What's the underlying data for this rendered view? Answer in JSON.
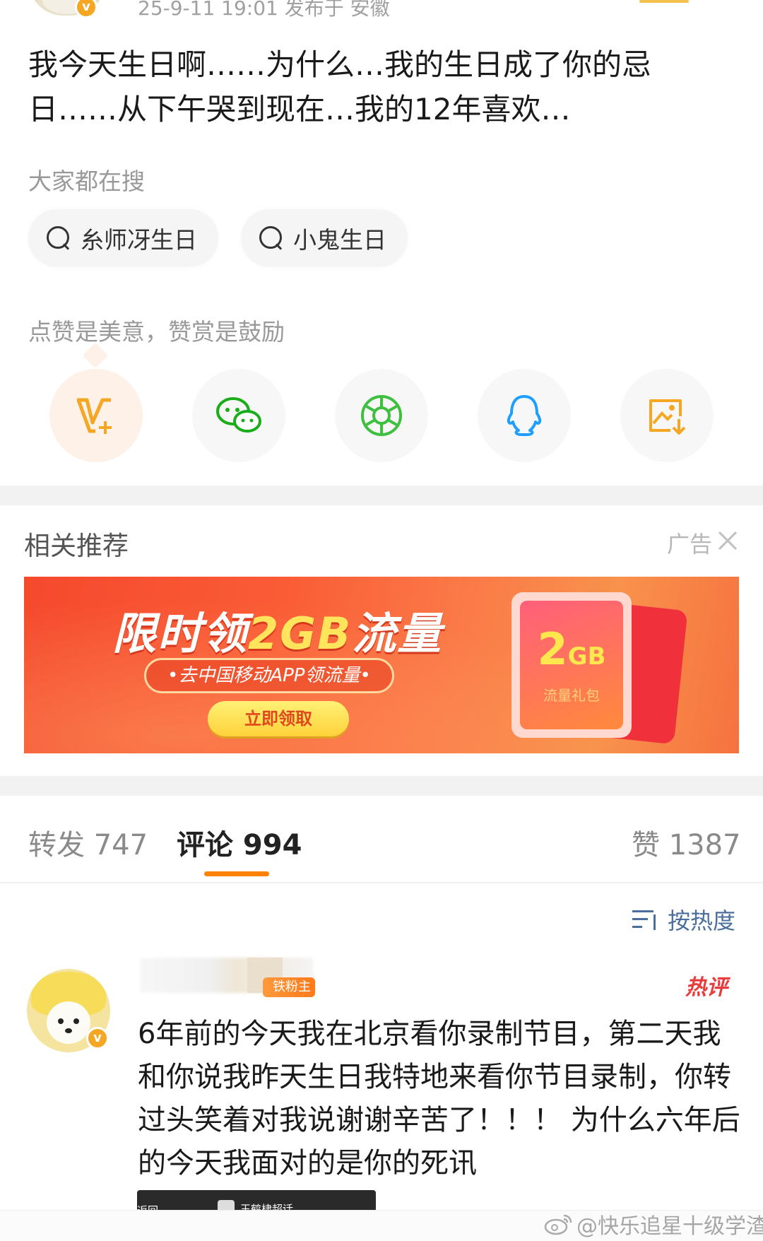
{
  "post": {
    "meta": "25-9-11 19:01 发布于 安徽",
    "text": "我今天生日啊……为什么…我的生日成了你的忌日……从下午哭到现在…我的12年喜欢…"
  },
  "hot_search": {
    "title": "大家都在搜",
    "items": [
      {
        "label": "糸师冴生日"
      },
      {
        "label": "小鬼生日"
      }
    ]
  },
  "reward_hint": "点赞是美意，赞赏是鼓励",
  "share": [
    {
      "icon": "v-plus-reward-icon",
      "color": "#f5a623"
    },
    {
      "icon": "wechat-icon",
      "color": "#1aad19"
    },
    {
      "icon": "moments-icon",
      "color": "#3fbf3f"
    },
    {
      "icon": "qq-icon",
      "color": "#1e9fff"
    },
    {
      "icon": "save-image-icon",
      "color": "#f5a623"
    }
  ],
  "recommend": {
    "title": "相关推荐",
    "ad_label": "广告"
  },
  "ad": {
    "headline_prefix": "限时领",
    "headline_highlight": "2GB",
    "headline_suffix": "流量",
    "sub": "•去中国移动APP领流量•",
    "cta": "立即领取",
    "card_big": "2",
    "card_unit": "GB",
    "card_small": "流量礼包"
  },
  "tabs": {
    "repost": "转发 747",
    "comment": "评论 994",
    "like": "赞 1387"
  },
  "sort": {
    "label": "按热度"
  },
  "comment": {
    "fan_badge": "铁粉主",
    "hot_label": "热评",
    "text": "6年前的今天我在北京看你录制节目，第二天我和你说我昨天生日我特地来看你节目录制，你转过头笑着对我说谢谢辛苦了！！！ 为什么六年后的今天我面对的是你的死讯",
    "media_back": "返回",
    "media_label": "王鹤棣超话"
  },
  "watermark": "@快乐追星十级学渣",
  "colors": {
    "accent": "#ff8200",
    "link": "#4a6f9c",
    "hot": "#e83b3b"
  }
}
